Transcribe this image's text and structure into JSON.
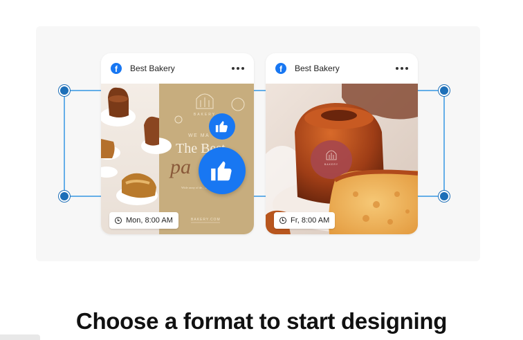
{
  "colors": {
    "facebook_blue": "#1877f2",
    "selection_blue": "#1d6fb8",
    "panel_bg": "#f7f7f7"
  },
  "posts": [
    {
      "page_name": "Best Bakery",
      "scheduled_time": "Mon, 8:00 AM",
      "design_text": {
        "brand": "BAKERY",
        "tagline": "WE MA",
        "title": "The Best",
        "script": "pa",
        "body": "Wide array of de... to treat all",
        "url": "BAKERY.COM"
      }
    },
    {
      "page_name": "Best Bakery",
      "scheduled_time": "Fr, 8:00 AM",
      "design_text": {
        "brand": "BAKERY"
      }
    }
  ],
  "headline": "Choose a format to start designing"
}
